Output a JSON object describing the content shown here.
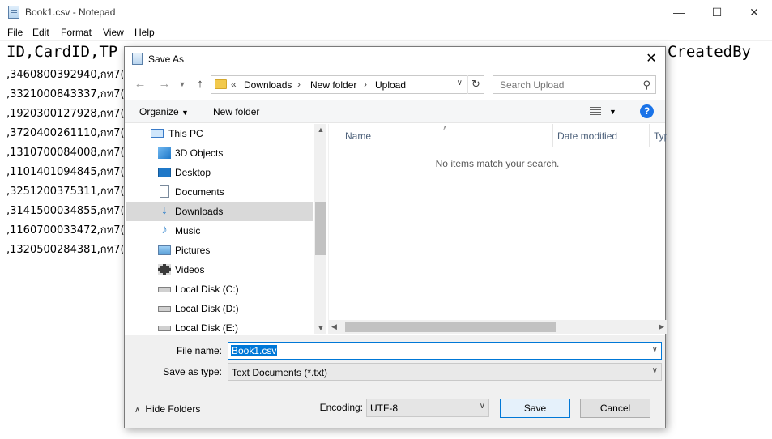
{
  "notepad": {
    "title": "Book1.csv - Notepad",
    "menu": [
      "File",
      "Edit",
      "Format",
      "View",
      "Help"
    ],
    "header_visible": "ID,CardID,TP",
    "header_tail": "CreatedBy",
    "rows": [
      ",3460800392940,กท7(1",
      ",3321000843337,กท7(1",
      ",1920300127928,กท7(1",
      ",3720400261110,กท7(1",
      ",1310700084008,กท7(1",
      ",1101401094845,กท7(1",
      ",3251200375311,กท7(1",
      ",3141500034855,กท7(1",
      ",1160700033472,กท7(1",
      ",1320500284381,กท7(1"
    ]
  },
  "dialog": {
    "title": "Save As",
    "address": {
      "prefix": "«",
      "parts": [
        "Downloads",
        "New folder",
        "Upload"
      ]
    },
    "search_placeholder": "Search Upload",
    "toolbar": {
      "organize": "Organize",
      "new_folder": "New folder"
    },
    "nav_items": [
      {
        "label": "This PC",
        "icon": "computer-icon",
        "selected": false
      },
      {
        "label": "3D Objects",
        "icon": "cube-icon",
        "selected": false
      },
      {
        "label": "Desktop",
        "icon": "desktop-icon",
        "selected": false
      },
      {
        "label": "Documents",
        "icon": "document-icon",
        "selected": false
      },
      {
        "label": "Downloads",
        "icon": "download-arrow-icon",
        "selected": true
      },
      {
        "label": "Music",
        "icon": "music-note-icon",
        "selected": false
      },
      {
        "label": "Pictures",
        "icon": "picture-icon",
        "selected": false
      },
      {
        "label": "Videos",
        "icon": "film-icon",
        "selected": false
      },
      {
        "label": "Local Disk (C:)",
        "icon": "drive-icon",
        "selected": false
      },
      {
        "label": "Local Disk (D:)",
        "icon": "drive-icon",
        "selected": false
      },
      {
        "label": "Local Disk (E:)",
        "icon": "drive-icon",
        "selected": false
      }
    ],
    "columns": [
      "Name",
      "Date modified",
      "Typ"
    ],
    "empty_message": "No items match your search.",
    "file_name_label": "File name:",
    "file_name_value": "Book1.csv",
    "save_type_label": "Save as type:",
    "save_type_value": "Text Documents (*.txt)",
    "hide_folders": "Hide Folders",
    "encoding_label": "Encoding:",
    "encoding_value": "UTF-8",
    "save_button": "Save",
    "cancel_button": "Cancel"
  },
  "colors": {
    "accent": "#0078d7",
    "selected_nav": "#d9d9d9",
    "folder": "#f2c94c"
  }
}
